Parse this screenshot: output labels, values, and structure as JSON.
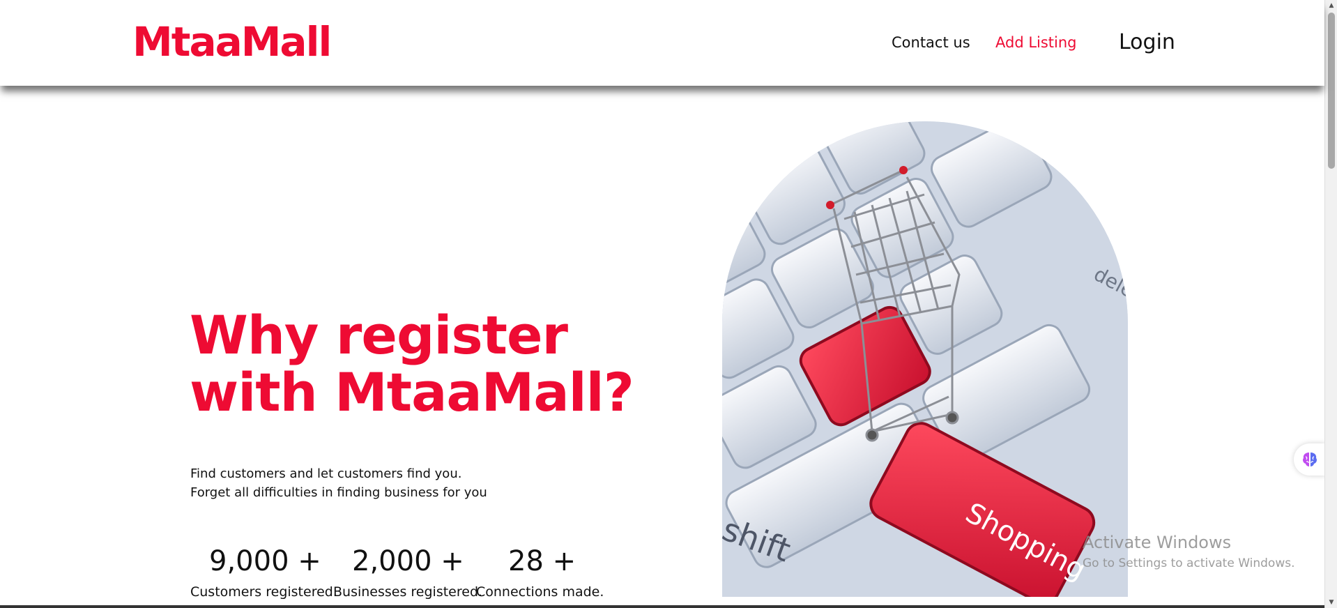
{
  "brand": {
    "logo": "MtaaMall",
    "accent_color": "#ee0b33"
  },
  "nav": {
    "contact": "Contact us",
    "add_listing": "Add Listing",
    "login": "Login"
  },
  "hero": {
    "title_line1": "Why register",
    "title_line2": "with MtaaMall?",
    "subtitle_line1": "Find customers and let customers find you.",
    "subtitle_line2": "Forget all difficulties in finding business for you",
    "image": {
      "key_labels": [
        "shift",
        "Shopping",
        "dele"
      ],
      "icon": "shopping-cart-icon"
    }
  },
  "stats": [
    {
      "value": "9,000 +",
      "label": "Customers registered."
    },
    {
      "value": "2,000 +",
      "label": "Businesses registered."
    },
    {
      "value": "28 +",
      "label": "Connections made."
    }
  ],
  "watermark": {
    "title": "Activate Windows",
    "subtitle": "Go to Settings to activate Windows."
  },
  "widget": {
    "icon": "brain-icon"
  }
}
